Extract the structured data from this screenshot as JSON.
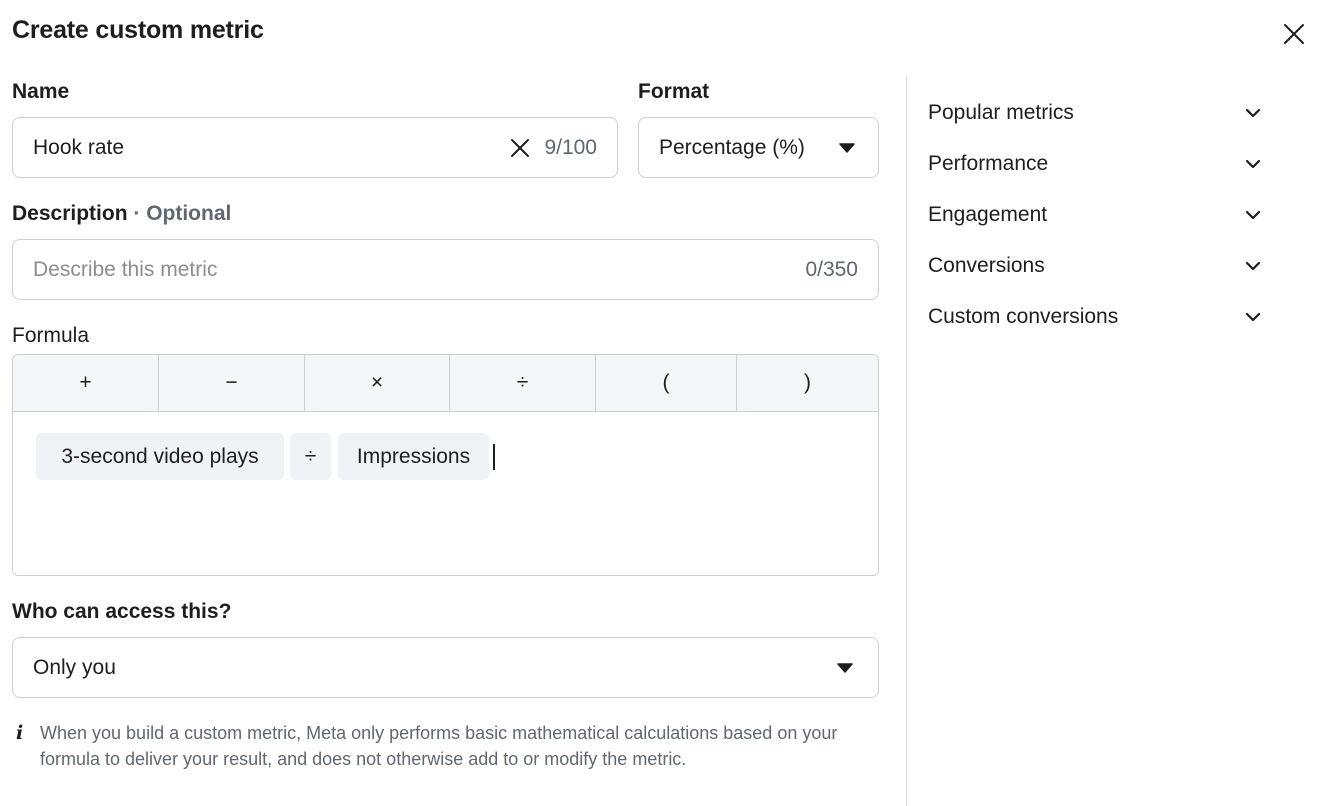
{
  "dialog": {
    "title": "Create custom metric"
  },
  "name_field": {
    "label": "Name",
    "value": "Hook rate",
    "counter": "9/100"
  },
  "format_field": {
    "label": "Format",
    "value": "Percentage (%)"
  },
  "description_field": {
    "label": "Description",
    "optional": " · Optional",
    "placeholder": "Describe this metric",
    "counter": "0/350"
  },
  "formula": {
    "label": "Formula",
    "operators": [
      "+",
      "−",
      "×",
      "÷",
      "(",
      ")"
    ],
    "tokens": [
      "3-second video plays",
      "÷",
      "Impressions"
    ]
  },
  "access": {
    "label": "Who can access this?",
    "value": "Only you"
  },
  "info": {
    "icon": "info-icon",
    "text": "When you build a custom metric, Meta only performs basic mathematical calculations based on your formula to deliver your result, and does not otherwise add to or modify the metric."
  },
  "sidebar": {
    "items": [
      {
        "label": "Popular metrics"
      },
      {
        "label": "Performance"
      },
      {
        "label": "Engagement"
      },
      {
        "label": "Conversions"
      },
      {
        "label": "Custom conversions"
      }
    ]
  }
}
